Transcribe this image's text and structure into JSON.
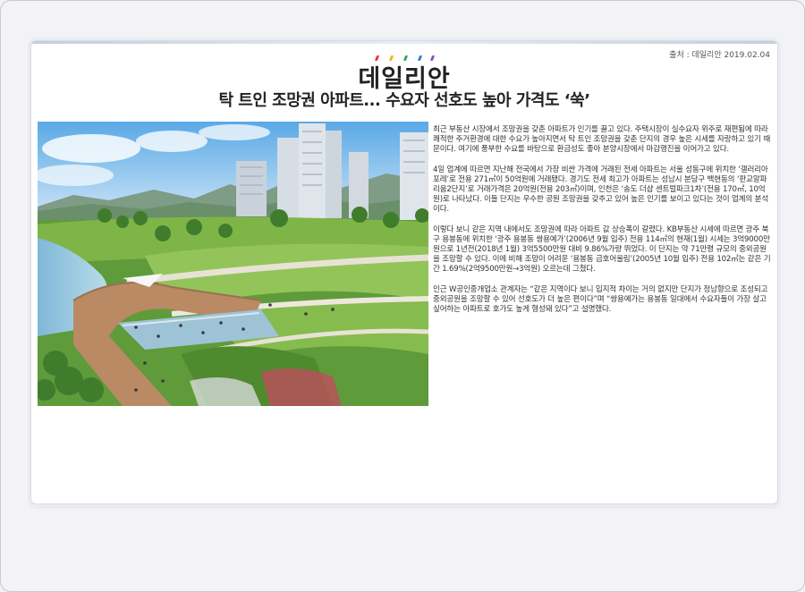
{
  "source": "출처 : 데일리안 2019.02.04",
  "logo_text": "데일리안",
  "headline": "탁 트인 조망권 아파트... 수요자 선호도 높아 가격도 ‘쑥’",
  "photo": {
    "icon": "apartment-park-rendering"
  },
  "colors": {
    "accent_dots": [
      "#e8353b",
      "#f3b11a",
      "#2fa84f",
      "#2d7fd1",
      "#8a4fc2"
    ]
  },
  "paragraphs": [
    "최근 부동산 시장에서 조망권을 갖춘 아파트가 인기를 끌고 있다. 주택시장이 실수요자 위주로 재편됨에 따라 쾌적한 주거환경에 대한 수요가 높아지면서 탁 트인 조망권을 갖춘 단지의 경우 높은 시세를 자랑하고 있기 때문이다. 여기에 풍부한 수요를 바탕으로 환금성도 좋아 분양시장에서 마감행진을 이어가고 있다.",
    "4일 업계에 따르면 지난해 전국에서 가장 비싼 가격에 거래된 전세 아파트는 서울 성동구에 위치한 ‘갤러리아포레’로 전용 271㎡이 50억원에 거래됐다. 경기도 전세 최고가 아파트는 성남시 분당구 백현동의 ‘판교알파리움2단지’로 거래가격은 20억원(전용 203㎡)이며, 인천은 ‘송도 더샵 센트럴파크1차’(전용 170㎡, 10억원)로 나타났다. 이들 단지는 우수한 공원 조망권을 갖추고 있어 높은 인기를 보이고 있다는 것이 업계의 분석이다.",
    "이렇다 보니 같은 지역 내에서도 조망권에 따라 아파트 값 상승폭이 갈렸다. KB부동산 시세에 따르면 광주 북구 용봉동에 위치한 ‘광주 용봉동 쌍용예가’(2006년 9월 입주) 전용 114㎡의 현재(1월) 시세는 3억9000만원으로 1년전(2018년 1월) 3억5500만원 대비 9.86%가량 뛰었다. 이 단지는 약 71만평 규모의 중외공원을 조망할 수 있다. 이에 비해 조망이 어려운 ‘용봉동 금호어울림’(2005년 10월 입주) 전용 102㎡는 같은 기간 1.69%(2억9500만원→3억원) 오르는데 그쳤다.",
    "인근 W공인중개업소 관계자는 “같은 지역이다 보니 입지적 차이는 거의 없지만 단지가 정남향으로 조성되고 중외공원을 조망할 수 있어 선호도가 더 높은 편이다”며 “쌍용예가는 용봉동 일대에서 수요자들이 가장 살고 싶어하는 아파트로 호가도 높게 형성돼 있다”고 설명했다."
  ]
}
